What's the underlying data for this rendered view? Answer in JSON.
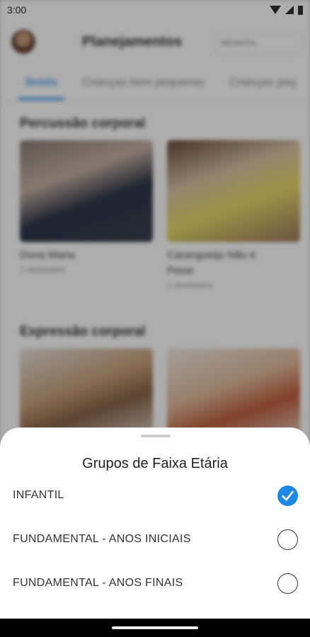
{
  "status_bar": {
    "time": "3:00"
  },
  "background": {
    "title": "Planejamentos",
    "group_select": "INFANTIL",
    "tabs": [
      "Bebês",
      "Crianças bem pequenas",
      "Crianças peq"
    ],
    "sections": [
      {
        "title": "Percussão corporal",
        "cards": [
          {
            "title": "Dona Maria",
            "subtitle": "1 atividades"
          },
          {
            "title": "Carangueijo Não é Peixe",
            "subtitle": "1 atividades"
          }
        ]
      },
      {
        "title": "Expressão corporal"
      }
    ]
  },
  "sheet": {
    "title": "Grupos de Faixa Etária",
    "options": [
      {
        "label": "INFANTIL",
        "selected": true
      },
      {
        "label": "FUNDAMENTAL - ANOS INICIAIS",
        "selected": false
      },
      {
        "label": "FUNDAMENTAL - ANOS FINAIS",
        "selected": false
      }
    ]
  },
  "colors": {
    "accent": "#1e88e5"
  }
}
